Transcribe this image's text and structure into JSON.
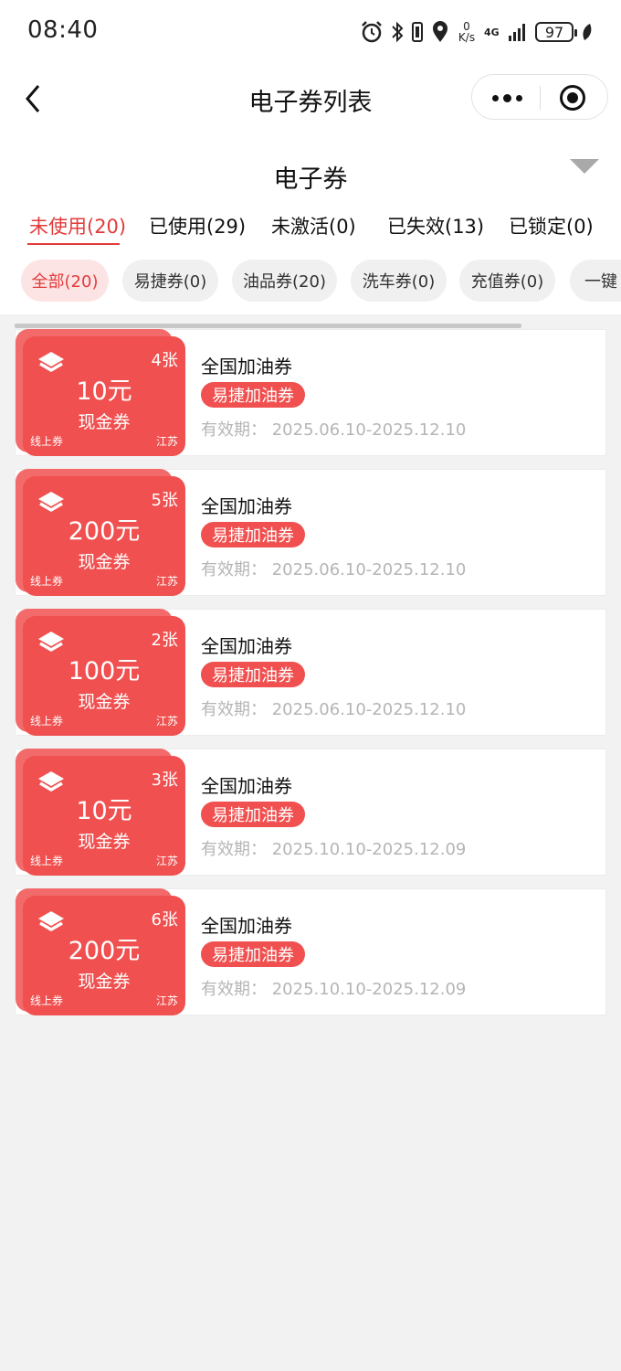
{
  "status_bar": {
    "time": "08:40",
    "net_speed_value": "0",
    "net_speed_unit": "K/s",
    "network": "4G",
    "battery": "97"
  },
  "nav": {
    "title": "电子券列表"
  },
  "section": {
    "title": "电子券"
  },
  "status_tabs": [
    {
      "label": "未使用(20)",
      "active": true
    },
    {
      "label": "已使用(29)",
      "active": false
    },
    {
      "label": "未激活(0)",
      "active": false
    },
    {
      "label": "已失效(13)",
      "active": false
    },
    {
      "label": "已锁定(0)",
      "active": false
    }
  ],
  "category_chips": [
    {
      "label": "全部(20)",
      "active": true
    },
    {
      "label": "易捷券(0)",
      "active": false
    },
    {
      "label": "油品券(20)",
      "active": false
    },
    {
      "label": "洗车券(0)",
      "active": false
    },
    {
      "label": "充值券(0)",
      "active": false
    },
    {
      "label": "一键",
      "active": false
    }
  ],
  "coupons": [
    {
      "count": "4张",
      "amount": "10元",
      "type": "现金券",
      "channel": "线上券",
      "region": "江苏",
      "title": "全国加油券",
      "tag": "易捷加油券",
      "validity_label": "有效期：",
      "validity": "2025.06.10-2025.12.10"
    },
    {
      "count": "5张",
      "amount": "200元",
      "type": "现金券",
      "channel": "线上券",
      "region": "江苏",
      "title": "全国加油券",
      "tag": "易捷加油券",
      "validity_label": "有效期：",
      "validity": "2025.06.10-2025.12.10"
    },
    {
      "count": "2张",
      "amount": "100元",
      "type": "现金券",
      "channel": "线上券",
      "region": "江苏",
      "title": "全国加油券",
      "tag": "易捷加油券",
      "validity_label": "有效期：",
      "validity": "2025.06.10-2025.12.10"
    },
    {
      "count": "3张",
      "amount": "10元",
      "type": "现金券",
      "channel": "线上券",
      "region": "江苏",
      "title": "全国加油券",
      "tag": "易捷加油券",
      "validity_label": "有效期：",
      "validity": "2025.10.10-2025.12.09"
    },
    {
      "count": "6张",
      "amount": "200元",
      "type": "现金券",
      "channel": "线上券",
      "region": "江苏",
      "title": "全国加油券",
      "tag": "易捷加油券",
      "validity_label": "有效期：",
      "validity": "2025.10.10-2025.12.09"
    }
  ],
  "colors": {
    "accent": "#e23b3b",
    "coupon_red": "#f0504f",
    "chip_active_bg": "#fde4e4"
  },
  "icons": [
    "alarm-icon",
    "bluetooth-icon",
    "vibrate-icon",
    "location-icon",
    "signal-icon",
    "battery-icon",
    "leaf-icon",
    "back-icon",
    "more-icon",
    "close-mini-program-icon",
    "dropdown-triangle-icon",
    "layers-icon"
  ]
}
